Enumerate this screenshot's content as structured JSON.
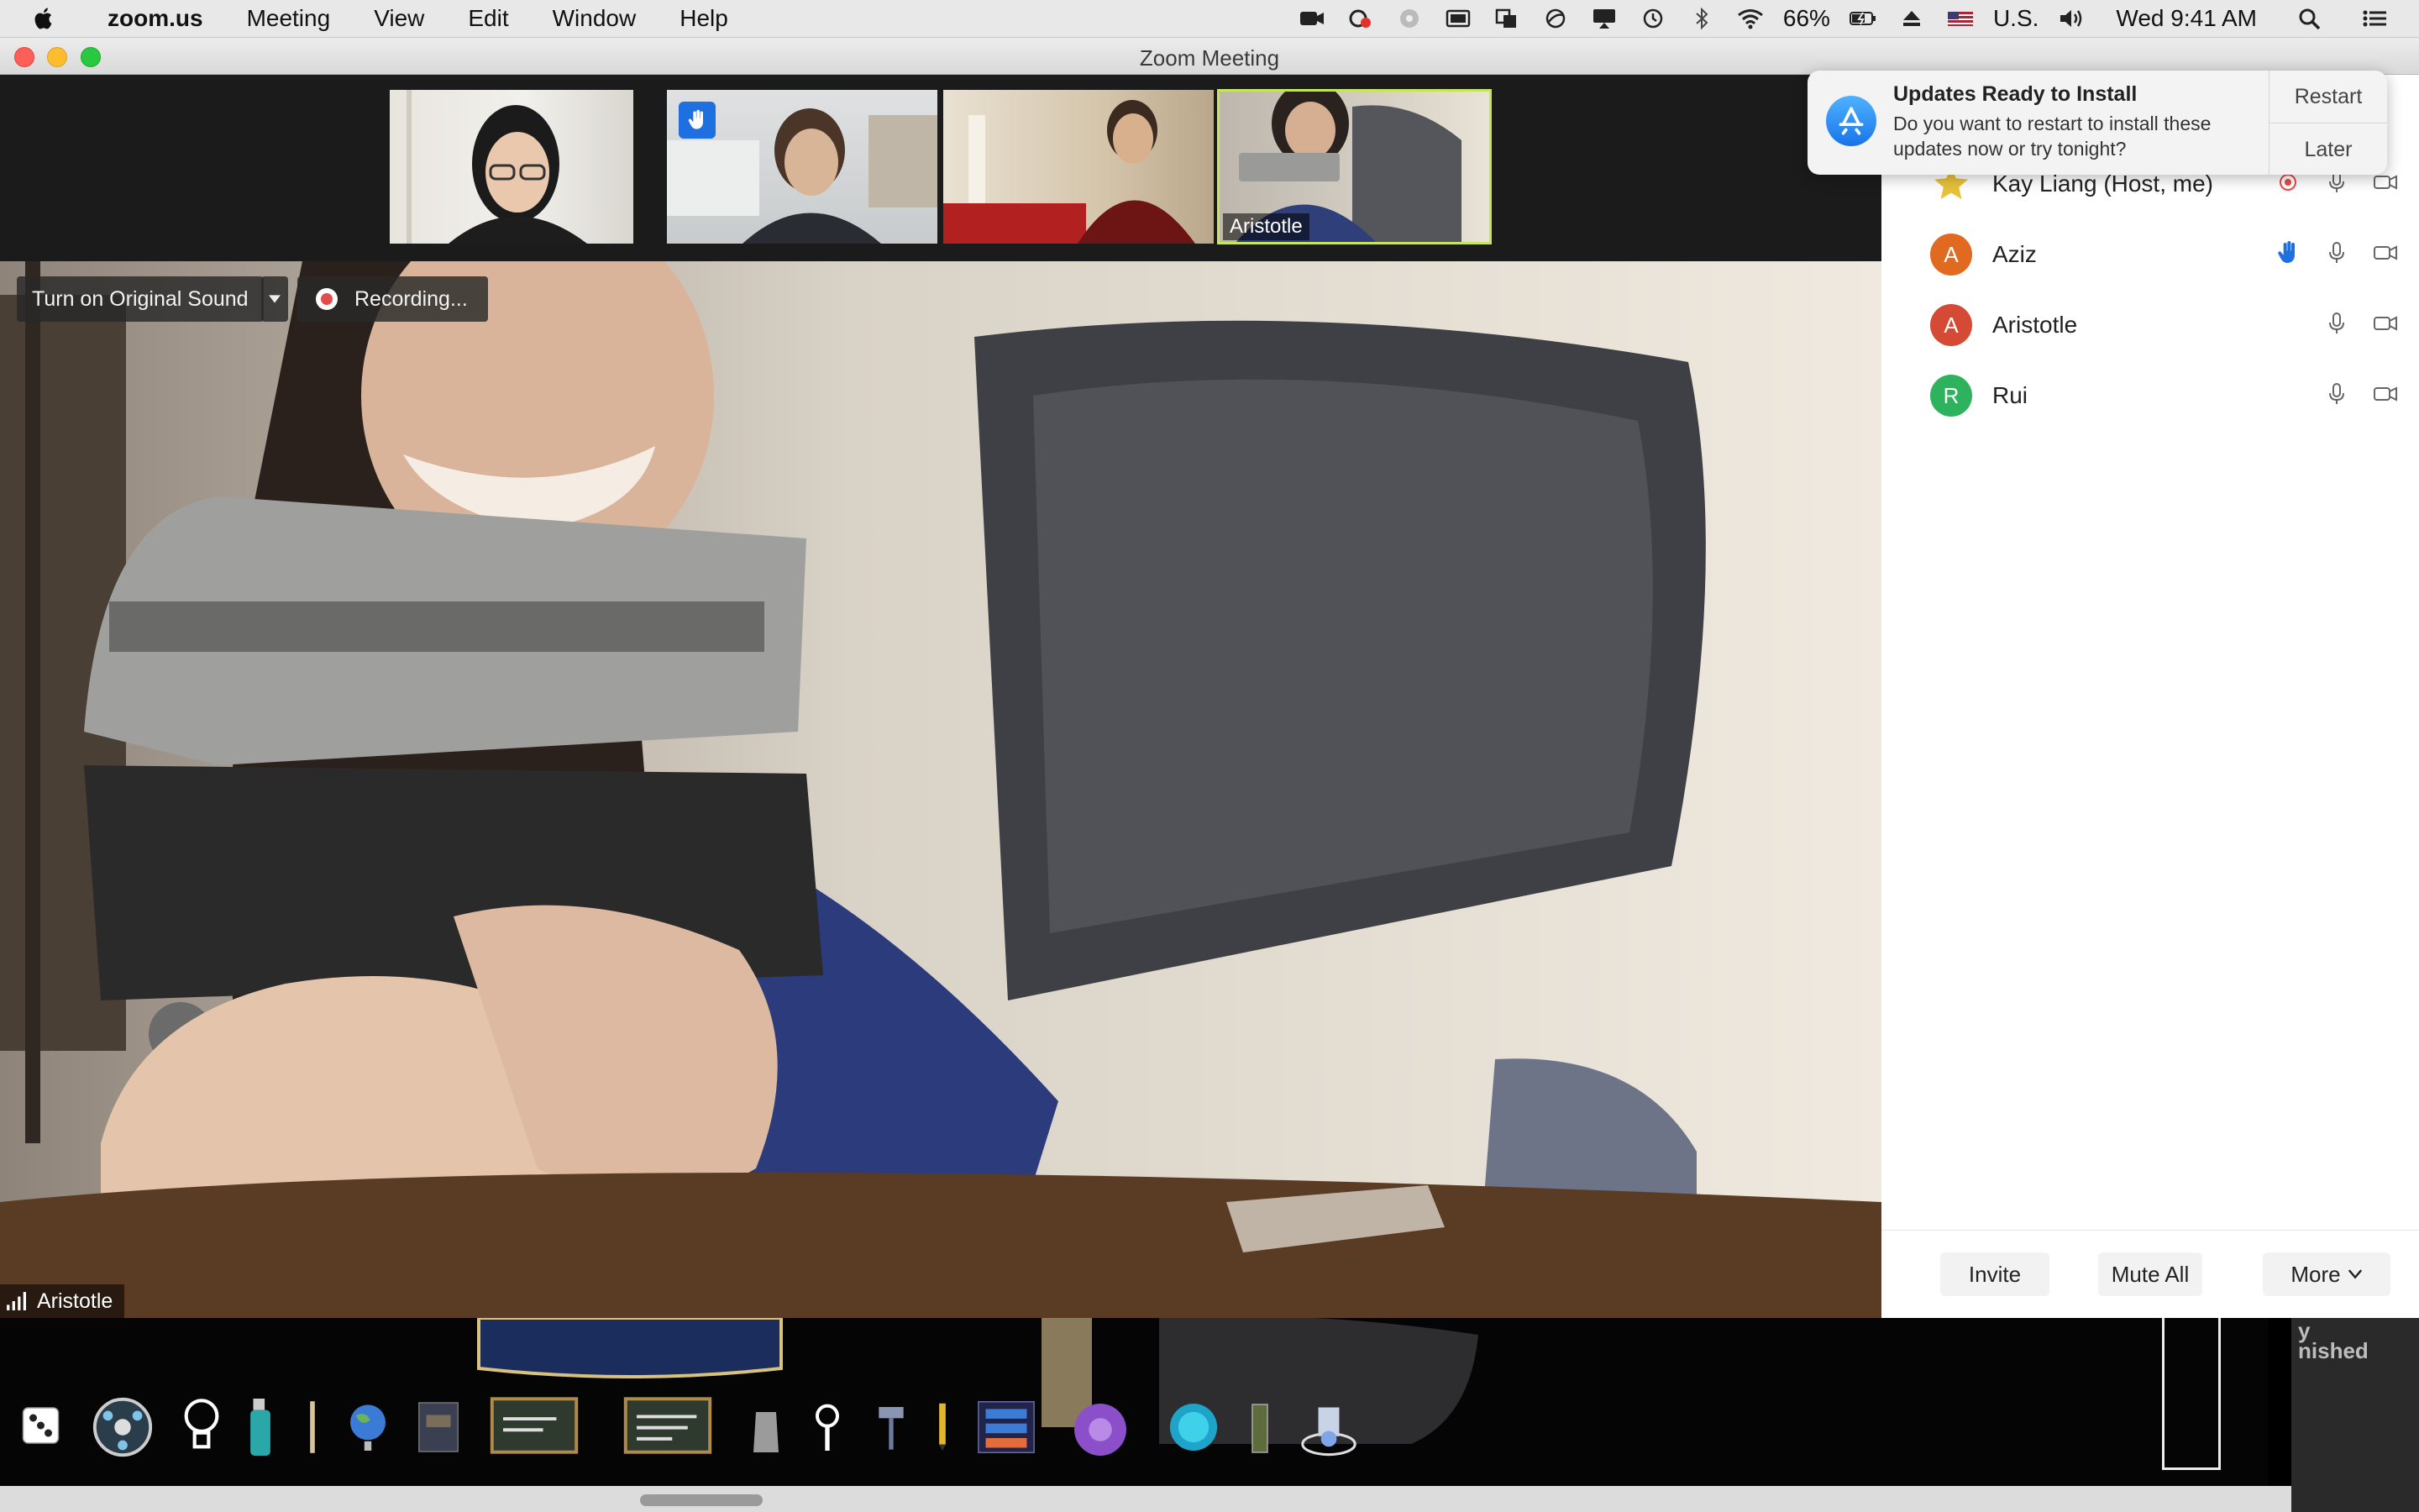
{
  "menubar": {
    "app_name": "zoom.us",
    "menus": [
      "Meeting",
      "View",
      "Edit",
      "Window",
      "Help"
    ],
    "battery": "66%",
    "input_source": "U.S.",
    "clock": "Wed 9:41 AM",
    "status_icons": [
      "zoom-video-icon",
      "creative-cloud-icon",
      "screen-share-icon",
      "display-icon",
      "copy-icon",
      "sync-icon",
      "airplay-icon",
      "time-machine-icon",
      "bluetooth-icon",
      "wifi-icon",
      "battery-icon",
      "eject-icon",
      "flag-icon",
      "volume-icon",
      "spotlight-icon",
      "notification-center-icon"
    ]
  },
  "window": {
    "title": "Zoom Meeting",
    "traffic_lights": {
      "close": "#ff5f57",
      "minimize": "#febc2e",
      "zoom": "#28c840"
    }
  },
  "thumbnails": [
    {
      "name": ""
    },
    {
      "name": "",
      "raised_hand": true
    },
    {
      "name": ""
    },
    {
      "name": "Aristotle",
      "active": true
    }
  ],
  "main_video": {
    "original_sound_label": "Turn on Original Sound",
    "recording_label": "Recording...",
    "speaker_name": "Aristotle"
  },
  "participants": [
    {
      "initial": "",
      "name": "Kay Liang (Host, me)",
      "avatar_color": "#e8c23a",
      "recording": true,
      "raised_hand": false
    },
    {
      "initial": "A",
      "name": "Aziz",
      "avatar_color": "#e06a20",
      "recording": false,
      "raised_hand": true
    },
    {
      "initial": "A",
      "name": "Aristotle",
      "avatar_color": "#d44a34",
      "recording": false,
      "raised_hand": false
    },
    {
      "initial": "R",
      "name": "Rui",
      "avatar_color": "#2fb25e",
      "recording": false,
      "raised_hand": false
    }
  ],
  "panel_footer": {
    "invite": "Invite",
    "mute_all": "Mute All",
    "more": "More"
  },
  "notification": {
    "title": "Updates Ready to Install",
    "body": "Do you want to restart to install these updates now or try tonight?",
    "restart": "Restart",
    "later": "Later"
  },
  "dock": {
    "side_text_1": "y",
    "side_text_2": "nished",
    "items": [
      "dice-icon",
      "dial-icon",
      "lightbulb-icon",
      "spray-bottle-icon",
      "brush-icon",
      "globe-icon",
      "book-icon",
      "chalkboard-icon",
      "chalkboard-icon",
      "bag-icon",
      "magnifier-icon",
      "hammer-icon",
      "pencil-icon",
      "keyboard-icon",
      "flower-icon",
      "orb-icon",
      "bottle-icon",
      "robot-icon"
    ]
  },
  "colors": {
    "accent": "#1e6fe0",
    "active_border": "#c8e35c",
    "recording_dot": "#e54b4b"
  }
}
